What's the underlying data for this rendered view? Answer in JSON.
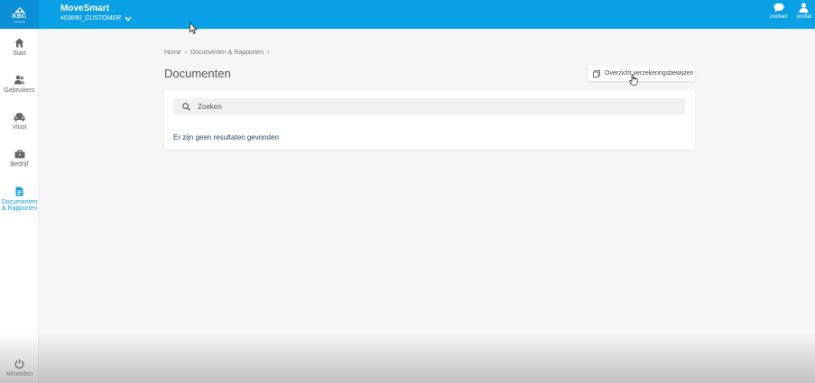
{
  "brand": {
    "logo_text": "KBC",
    "logo_sub": "Autolease"
  },
  "header": {
    "app_title": "MoveSmart",
    "customer_id": "403890_CUSTOMER",
    "actions": [
      {
        "label": "contact",
        "icon": "chat-bubble-icon"
      },
      {
        "label": "profiel",
        "icon": "user-icon"
      }
    ]
  },
  "sidebar": {
    "items": [
      {
        "label": "Start",
        "icon": "home-icon"
      },
      {
        "label": "Gebruikers",
        "icon": "users-icon"
      },
      {
        "label": "Vloot",
        "icon": "car-icon"
      },
      {
        "label": "Bedrijf",
        "icon": "briefcase-icon"
      },
      {
        "label_line1": "Documenten",
        "label_line2": "& Rapporten",
        "icon": "document-icon",
        "active": true
      }
    ],
    "logout_label": "Afmelden"
  },
  "breadcrumb": {
    "home": "Home",
    "documents": "Documenten & Rapporten"
  },
  "main": {
    "title": "Documenten",
    "overview_button": "Overzicht verzekeringsbewijzen",
    "search_placeholder": "Zoeken",
    "no_results": "Er zijn geen resultaten gevonden"
  },
  "colors": {
    "header": "#0aa0e6",
    "accent": "#16a0dc",
    "background": "#f6f6f6"
  }
}
